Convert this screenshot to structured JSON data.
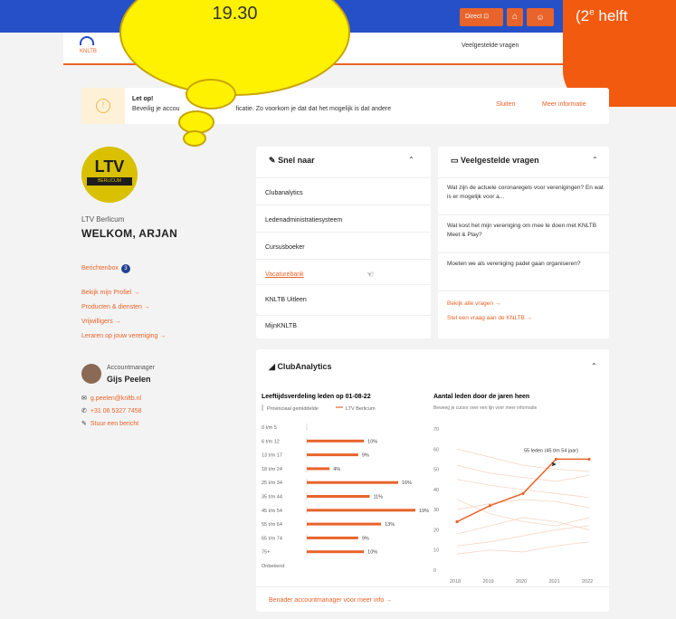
{
  "header": {
    "direct_label": "Direct",
    "home_icon": "home-icon",
    "user_icon": "user-icon"
  },
  "nav": {
    "logo_text": "KNLTB",
    "faq_link": "Veelgestelde vragen"
  },
  "overlay": {
    "bubble_time": "19.30",
    "orange_text": "(2",
    "orange_sup": "e",
    "orange_text2": " helft"
  },
  "alert": {
    "title": "Let op!",
    "body": "Beveilig je accou",
    "body2": "ficatie. Zo voorkom je dat dat het mogelijk is dat andere",
    "close": "Sluiten",
    "more": "Meer informatie"
  },
  "sidebar": {
    "logo_text": "LTV",
    "logo_sub": "BERLICUM",
    "club_name": "LTV Berlicum",
    "welcome": "WELKOM, ARJAN",
    "inbox": "Berichtenbox",
    "inbox_count": "3",
    "links": [
      "Bekijk mijn Profiel →",
      "Producten & diensten →",
      "Vrijwilligers →",
      "Leraren op jouw vereniging →"
    ],
    "account_role": "Accountmanager",
    "account_name": "Gijs Peelen",
    "email": "g.peelen@knltb.nl",
    "phone": "+31 06 5327 7458",
    "message": "Stuur een bericht"
  },
  "quick": {
    "title": "Snel naar",
    "items": [
      "Clubanalytics",
      "Ledenadministratiesysteem",
      "Cursusboeker",
      "Vacaturebank",
      "KNLTB Uitleen",
      "MijnKNLTB"
    ]
  },
  "faq": {
    "title": "Veelgestelde vragen",
    "questions": [
      "Wat zijn de actuele coronaregels voor verenigingen? En wat is er mogelijk voor a...",
      "Wat kost het mijn vereniging om mee te doen met KNLTB Meet & Play?",
      "Moeten we als vereniging padel gaan organiseren?"
    ],
    "all_link": "Bekijk alle vragen →",
    "ask_link": "Stel een vraag aan de KNLTB →"
  },
  "analytics": {
    "title": "ClubAnalytics",
    "footer": "Benader accountmanager voor meer info →"
  },
  "chart_data": [
    {
      "type": "bar",
      "title": "Leeftijdsverdeling leden op 01-08-22",
      "series": [
        {
          "name": "Provinciaal gemiddelde",
          "values": [
            null,
            null,
            null,
            null,
            null,
            null,
            null,
            null,
            null,
            null
          ]
        },
        {
          "name": "LTV Berlicum",
          "values": [
            0,
            10,
            9,
            4,
            16,
            11,
            19,
            13,
            9,
            10
          ]
        }
      ],
      "categories": [
        "0 t/m 5",
        "6 t/m 12",
        "13 t/m 17",
        "18 t/m 24",
        "25 t/m 34",
        "35 t/m 44",
        "45 t/m 54",
        "55 t/m 64",
        "65 t/m 74",
        "75+"
      ],
      "value_labels": [
        "",
        "10%",
        "9%",
        "4%",
        "16%",
        "11%",
        "19%",
        "13%",
        "9%",
        "10%"
      ],
      "extra_category": "Onbekend",
      "colors": {
        "accent": "#e8642a",
        "avg": "#cfcfcf"
      }
    },
    {
      "type": "line",
      "title": "Aantal leden door de jaren heen",
      "subtitle": "Beweeg je cursor over een lijn voor meer informatie",
      "x": [
        "2018",
        "2019",
        "2020",
        "2021",
        "2022"
      ],
      "yticks": [
        0,
        10,
        20,
        30,
        40,
        50,
        60,
        70
      ],
      "ylim": [
        0,
        70
      ],
      "series": [
        {
          "name": "45 t/m 54 jaar",
          "values": [
            24,
            32,
            38,
            55,
            55
          ]
        }
      ],
      "annotation": "55 leden (45 t/m 54 jaar)",
      "colors": {
        "accent": "#e8642a",
        "faint": "#f6d6c4"
      }
    }
  ]
}
